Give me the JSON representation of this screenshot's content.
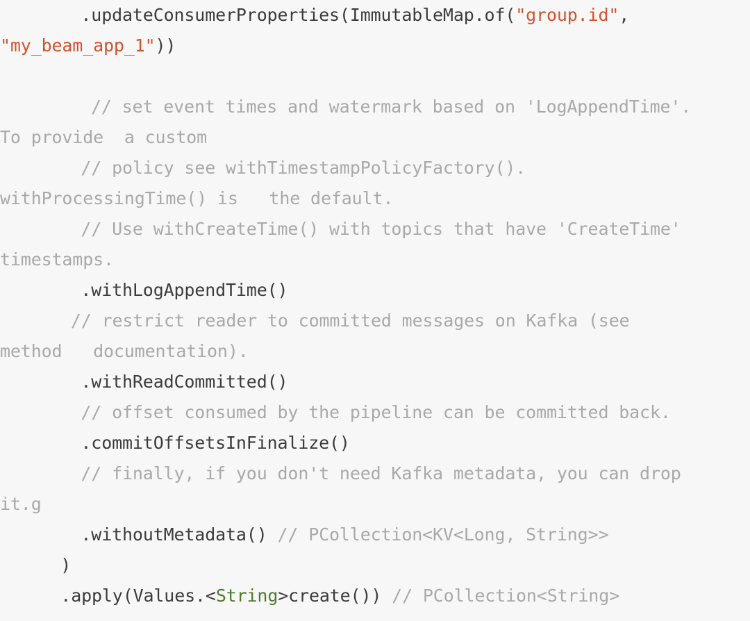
{
  "document": {
    "kind": "code-snippet",
    "language": "java",
    "background_color": "#f7f7f7",
    "colors": {
      "code": "#3c3c3c",
      "comment": "#a9a9a9",
      "string": "#d2522c",
      "type": "#4e7a2c"
    },
    "lines": [
      {
        "id": "line-1",
        "indent": 8,
        "tokens": [
          {
            "kind": "plain",
            "text": ".updateConsumerProperties(ImmutableMap.of("
          },
          {
            "kind": "string",
            "text": "\"group.id\""
          },
          {
            "kind": "plain",
            "text": ","
          }
        ]
      },
      {
        "id": "line-2",
        "indent": 0,
        "wrapped": true,
        "tokens": [
          {
            "kind": "string",
            "text": "\"my_beam_app_1\""
          },
          {
            "kind": "plain",
            "text": "))"
          }
        ]
      },
      {
        "id": "line-3",
        "indent": 0,
        "tokens": [
          {
            "kind": "plain",
            "text": ""
          }
        ]
      },
      {
        "id": "line-4",
        "indent": 9,
        "tokens": [
          {
            "kind": "comment",
            "text": "// set event times and watermark based on 'LogAppendTime'."
          }
        ]
      },
      {
        "id": "line-5",
        "indent": 0,
        "wrapped": true,
        "tokens": [
          {
            "kind": "comment",
            "text": "To provide  a custom"
          }
        ]
      },
      {
        "id": "line-6",
        "indent": 8,
        "tokens": [
          {
            "kind": "comment",
            "text": "// policy see withTimestampPolicyFactory()."
          }
        ]
      },
      {
        "id": "line-7",
        "indent": 0,
        "wrapped": true,
        "tokens": [
          {
            "kind": "comment",
            "text": "withProcessingTime() is   the default."
          }
        ]
      },
      {
        "id": "line-8",
        "indent": 8,
        "tokens": [
          {
            "kind": "comment",
            "text": "// Use withCreateTime() with topics that have 'CreateTime'"
          }
        ]
      },
      {
        "id": "line-9",
        "indent": 0,
        "wrapped": true,
        "tokens": [
          {
            "kind": "comment",
            "text": "timestamps."
          }
        ]
      },
      {
        "id": "line-10",
        "indent": 8,
        "tokens": [
          {
            "kind": "plain",
            "text": ".withLogAppendTime()"
          }
        ]
      },
      {
        "id": "line-11",
        "indent": 7,
        "tokens": [
          {
            "kind": "comment",
            "text": "// restrict reader to committed messages on Kafka (see"
          }
        ]
      },
      {
        "id": "line-12",
        "indent": 0,
        "wrapped": true,
        "tokens": [
          {
            "kind": "comment",
            "text": "method   documentation)."
          }
        ]
      },
      {
        "id": "line-13",
        "indent": 8,
        "tokens": [
          {
            "kind": "plain",
            "text": ".withReadCommitted()"
          }
        ]
      },
      {
        "id": "line-14",
        "indent": 8,
        "tokens": [
          {
            "kind": "comment",
            "text": "// offset consumed by the pipeline can be committed back."
          }
        ]
      },
      {
        "id": "line-15",
        "indent": 8,
        "tokens": [
          {
            "kind": "plain",
            "text": ".commitOffsetsInFinalize()"
          }
        ]
      },
      {
        "id": "line-16",
        "indent": 8,
        "tokens": [
          {
            "kind": "comment",
            "text": "// finally, if you don't need Kafka metadata, you can drop"
          }
        ]
      },
      {
        "id": "line-17",
        "indent": 0,
        "wrapped": true,
        "tokens": [
          {
            "kind": "comment",
            "text": "it.g"
          }
        ]
      },
      {
        "id": "line-18",
        "indent": 8,
        "tokens": [
          {
            "kind": "plain",
            "text": ".withoutMetadata() "
          },
          {
            "kind": "comment",
            "text": "// PCollection<KV<Long, String>>"
          }
        ]
      },
      {
        "id": "line-19",
        "indent": 6,
        "tokens": [
          {
            "kind": "plain",
            "text": ")"
          }
        ]
      },
      {
        "id": "line-20",
        "indent": 6,
        "tokens": [
          {
            "kind": "plain",
            "text": ".apply(Values."
          },
          {
            "kind": "plain",
            "text": "<"
          },
          {
            "kind": "type",
            "text": "String"
          },
          {
            "kind": "plain",
            "text": ">create()) "
          },
          {
            "kind": "comment",
            "text": "// PCollection<String>"
          }
        ]
      }
    ]
  }
}
